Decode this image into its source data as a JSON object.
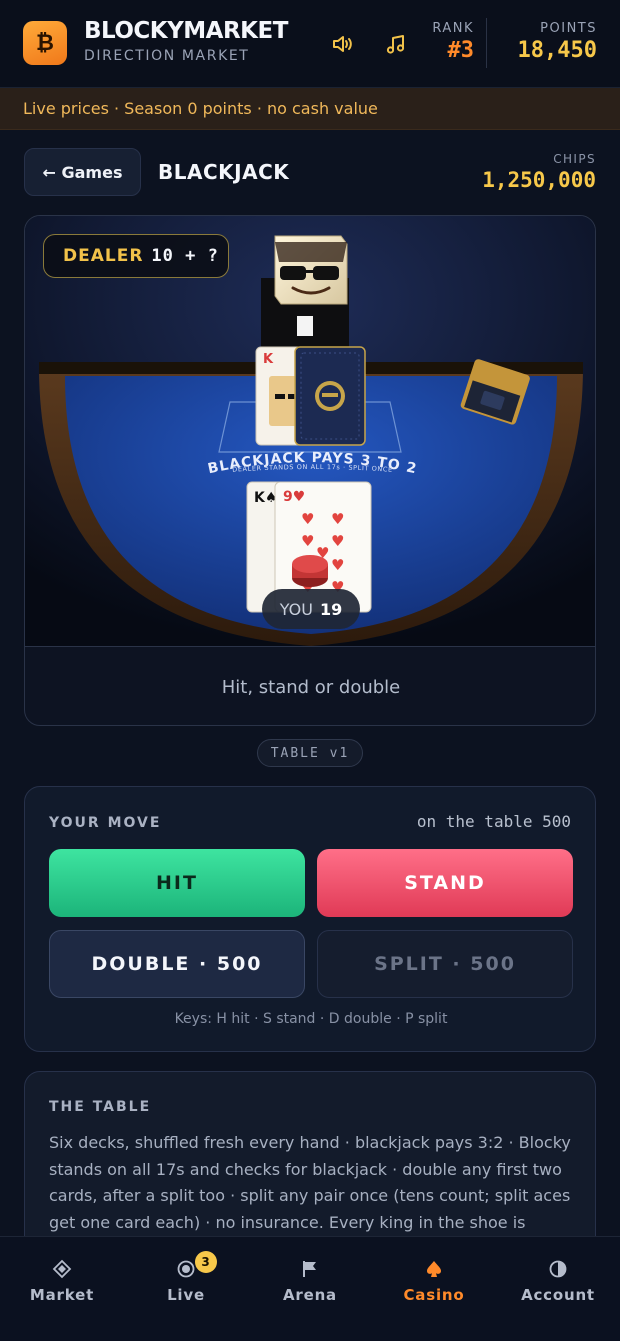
{
  "header": {
    "logo_glyph": "₿",
    "brand_title": "BLOCKYMARKET",
    "brand_sub": "DIRECTION MARKET",
    "rank_label": "RANK",
    "rank_value": "#3",
    "points_label": "POINTS",
    "points_value": "18,450",
    "icons": [
      "sound-icon",
      "music-icon"
    ]
  },
  "banner": {
    "text": "Live prices · Season 0 points · no cash value"
  },
  "game_bar": {
    "back_label": "← Games",
    "title": "BLACKJACK",
    "chips_label": "CHIPS",
    "chips_value": "1,250,000"
  },
  "table": {
    "dealer_label": "DEALER",
    "dealer_value": "10 + ?",
    "felt_text": "BLACKJACK PAYS 3 TO 2",
    "felt_subtext": "DEALER STANDS ON ALL 17s · SPLIT ONCE",
    "you_label": "YOU",
    "you_value": "19",
    "status": "Hit, stand or double",
    "version": "TABLE v1",
    "dealer_cards": [
      "K",
      "hidden"
    ],
    "player_cards": [
      "K♠",
      "9♥"
    ]
  },
  "move": {
    "label": "YOUR MOVE",
    "on_table": "on the table 500",
    "hit": "HIT",
    "stand": "STAND",
    "double": "DOUBLE · 500",
    "split": "SPLIT · 500",
    "keys_hint": "Keys: H hit · S stand · D double · P split"
  },
  "info": {
    "title": "THE TABLE",
    "text": "Six decks, shuffled fresh every hand · blackjack pays 3:2 · Blocky stands on all 17s and checks for blackjack · double any first two cards, after a split too · split any pair once (tens count; split aces get one card each) · no insurance. Every king in the shoe is Blocky."
  },
  "nav": {
    "items": [
      {
        "label": "Market",
        "icon": "market-icon"
      },
      {
        "label": "Live",
        "icon": "live-icon",
        "badge": "3"
      },
      {
        "label": "Arena",
        "icon": "flag-icon"
      },
      {
        "label": "Casino",
        "icon": "spade-icon",
        "active": true
      },
      {
        "label": "Account",
        "icon": "half-circle-icon"
      }
    ]
  },
  "colors": {
    "accent": "#ff8a2a",
    "gold": "#f7c84a",
    "hit": "#2ccf8c",
    "stand": "#f04e6a",
    "felt": "#1f4aa8"
  }
}
